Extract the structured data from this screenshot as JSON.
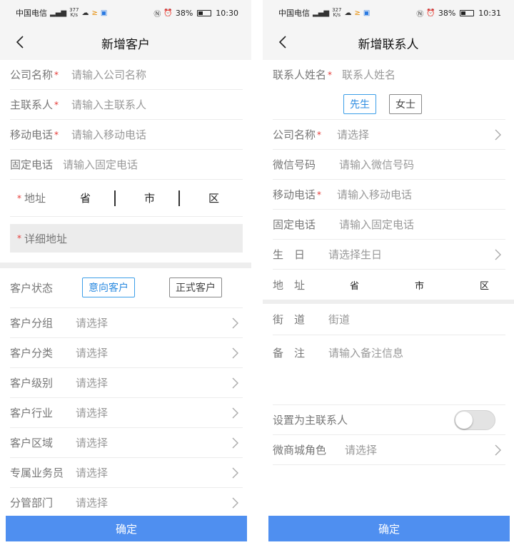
{
  "left": {
    "status": {
      "carrier": "中国电信",
      "speed_value": "377",
      "speed_unit": "K/s",
      "battery": "38%",
      "battery_level": 0.38,
      "time": "10:30"
    },
    "title": "新增客户",
    "fields": [
      {
        "label": "公司名称",
        "placeholder": "请输入公司名称"
      },
      {
        "label": "主联系人",
        "placeholder": "请输入主联系人"
      },
      {
        "label": "移动电话",
        "placeholder": "请输入移动电话"
      },
      {
        "label": "固定电话",
        "placeholder": "请输入固定电话"
      }
    ],
    "address_label": "地址",
    "province": "省",
    "city": "市",
    "district": "区",
    "detail_address": "详细地址",
    "status_label": "客户状态",
    "status_options": [
      "意向客户",
      "正式客户"
    ],
    "selects": [
      {
        "label": "客户分组",
        "value": "请选择"
      },
      {
        "label": "客户分类",
        "value": "请选择"
      },
      {
        "label": "客户级别",
        "value": "请选择"
      },
      {
        "label": "客户行业",
        "value": "请选择"
      },
      {
        "label": "客户区域",
        "value": "请选择"
      },
      {
        "label": "专属业务员",
        "value": "请选择"
      },
      {
        "label": "分管部门",
        "value": "请选择"
      }
    ],
    "confirm": "确定"
  },
  "right": {
    "status": {
      "carrier": "中国电信",
      "speed_value": "327",
      "speed_unit": "K/s",
      "battery": "38%",
      "battery_level": 0.38,
      "time": "10:31"
    },
    "title": "新增联系人",
    "name_label": "联系人姓名",
    "name_placeholder": "联系人姓名",
    "gender_options": [
      "先生",
      "女士"
    ],
    "company_label": "公司名称",
    "company_value": "请选择",
    "wechat_label": "微信号码",
    "wechat_placeholder": "请输入微信号码",
    "mobile_label": "移动电话",
    "mobile_placeholder": "请输入移动电话",
    "phone_label": "固定电话",
    "phone_placeholder": "请输入固定电话",
    "birthday_label": "生　日",
    "birthday_value": "请选择生日",
    "address_label": "地　址",
    "province": "省",
    "city": "市",
    "district": "区",
    "street_label": "街　道",
    "street_placeholder": "街道",
    "remark_label": "备　注",
    "remark_placeholder": "请输入备注信息",
    "primary_label": "设置为主联系人",
    "primary_on": false,
    "role_label": "微商城角色",
    "role_value": "请选择",
    "confirm": "确定"
  },
  "colors": {
    "accent": "#4f8ff0",
    "required": "#e53935",
    "active_border": "#3c9ee8"
  }
}
